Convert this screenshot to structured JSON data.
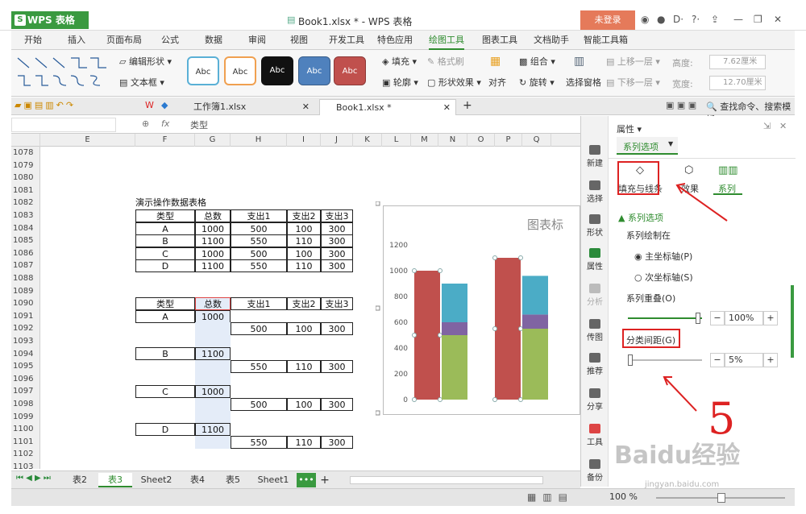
{
  "app": {
    "name": "WPS 表格",
    "doc_title": "Book1.xlsx * - WPS 表格",
    "login": "未登录"
  },
  "menu_tabs": [
    "开始",
    "插入",
    "页面布局",
    "公式",
    "数据",
    "审阅",
    "视图",
    "开发工具",
    "特色应用",
    "绘图工具",
    "图表工具",
    "文档助手",
    "智能工具箱"
  ],
  "ribbon": {
    "edit_shape": "编辑形状",
    "text_box": "文本框",
    "style_label": "Abc",
    "fill": "填充",
    "format_brush": "格式刷",
    "outline": "轮廓",
    "shape_effect": "形状效果",
    "align": "对齐",
    "group": "组合",
    "rotate": "旋转",
    "select_pane": "选择窗格",
    "bring_forward": "上移一层",
    "send_backward": "下移一层",
    "height_label": "高度:",
    "height_value": "7.62厘米",
    "width_label": "宽度:",
    "width_value": "12.70厘米"
  },
  "doc_tabs": [
    "工作簿1.xlsx",
    "Book1.xlsx *"
  ],
  "search_hint": "查找命令、搜索模板",
  "formula": {
    "fx": "fx",
    "content": "类型"
  },
  "columns": [
    "E",
    "F",
    "G",
    "H",
    "I",
    "J",
    "K",
    "L",
    "M",
    "N",
    "O",
    "P",
    "Q"
  ],
  "rows": [
    "1078",
    "1079",
    "1080",
    "1081",
    "1082",
    "1083",
    "1084",
    "1085",
    "1086",
    "1087",
    "1088",
    "1089",
    "1090",
    "1091",
    "1092",
    "1093",
    "1094",
    "1095",
    "1096",
    "1097",
    "1098",
    "1099",
    "1100",
    "1101",
    "1102",
    "1103"
  ],
  "table1": {
    "title": "演示操作数据表格",
    "headers": [
      "类型",
      "总数",
      "支出1",
      "支出2",
      "支出3"
    ],
    "rows": [
      [
        "A",
        "1000",
        "500",
        "100",
        "300"
      ],
      [
        "B",
        "1100",
        "550",
        "110",
        "300"
      ],
      [
        "C",
        "1000",
        "500",
        "100",
        "300"
      ],
      [
        "D",
        "1100",
        "550",
        "110",
        "300"
      ]
    ]
  },
  "table2": {
    "headers": [
      "类型",
      "总数",
      "支出1",
      "支出2",
      "支出3"
    ],
    "rows": [
      {
        "type": "A",
        "total": "1000",
        "e1": "500",
        "e2": "100",
        "e3": "300"
      },
      {
        "type": "B",
        "total": "1100",
        "e1": "550",
        "e2": "110",
        "e3": "300"
      },
      {
        "type": "C",
        "total": "1000",
        "e1": "500",
        "e2": "100",
        "e3": "300"
      },
      {
        "type": "D",
        "total": "1100",
        "e1": "550",
        "e2": "110",
        "e3": "300"
      }
    ]
  },
  "chart_data": {
    "type": "bar",
    "title": "图表标",
    "ylim": [
      0,
      1200
    ],
    "yticks": [
      "0",
      "200",
      "400",
      "600",
      "800",
      "1000",
      "1200"
    ],
    "groups": [
      {
        "total": 1000,
        "stack": [
          {
            "name": "支出1",
            "value": 500
          },
          {
            "name": "支出2",
            "value": 100
          },
          {
            "name": "支出3",
            "value": 300
          }
        ]
      },
      {
        "total": 1100,
        "stack": [
          {
            "name": "支出1",
            "value": 550
          },
          {
            "name": "支出2",
            "value": 110
          },
          {
            "name": "支出3",
            "value": 300
          }
        ]
      }
    ],
    "colors": {
      "total": "#c0504d",
      "e1": "#9bbb59",
      "e2": "#8064a2",
      "e3": "#4bacc6"
    }
  },
  "sidebar_items": [
    "新建",
    "选择",
    "形状",
    "属性",
    "分析",
    "传图",
    "推荐",
    "分享",
    "工具",
    "备份"
  ],
  "panel": {
    "title": "属性",
    "dropdown": "系列选项",
    "tabs": [
      "填充与线条",
      "效果",
      "系列"
    ],
    "section": "系列选项",
    "plot_on": "系列绘制在",
    "primary_axis": "主坐标轴(P)",
    "secondary_axis": "次坐标轴(S)",
    "overlap_label": "系列重叠(O)",
    "overlap_value": "100%",
    "gap_label": "分类间距(G)",
    "gap_value": "5%"
  },
  "sheet_tabs": [
    "表2",
    "表3",
    "Sheet2",
    "表4",
    "表5",
    "Sheet1"
  ],
  "zoom": "100 %",
  "annotation_number": "5",
  "watermark": {
    "text": "Baidu经验",
    "url": "jingyan.baidu.com"
  }
}
